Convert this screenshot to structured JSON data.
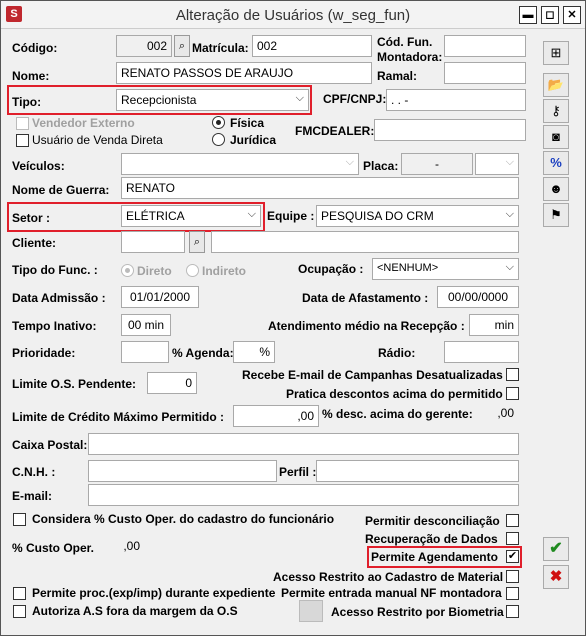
{
  "window": {
    "title": "Alteração de Usuários (w_seg_fun)",
    "app_icon": "S"
  },
  "codigo": {
    "label": "Código:",
    "value": "002"
  },
  "matricula": {
    "label": "Matrícula:",
    "value": "002"
  },
  "cod_fun_montadora": {
    "label_1": "Cód. Fun.",
    "label_2": "Montadora:",
    "value": ""
  },
  "nome": {
    "label": "Nome:",
    "value": "RENATO PASSOS DE ARAUJO"
  },
  "ramal": {
    "label": "Ramal:",
    "value": ""
  },
  "tipo": {
    "label": "Tipo:",
    "value": "Recepcionista"
  },
  "cpf": {
    "label": "CPF/CNPJ:",
    "value": " .  .  -"
  },
  "vendedor_externo": {
    "label": "Vendedor Externo",
    "checked": false
  },
  "usuario_venda_direta": {
    "label": "Usuário de Venda Direta",
    "checked": false
  },
  "pessoa": {
    "fisica": "Física",
    "juridica": "Jurídica",
    "selected": "fisica"
  },
  "fmcdealer": {
    "label": "FMCDEALER:",
    "value": ""
  },
  "veiculos": {
    "label": "Veículos:",
    "value": ""
  },
  "placa": {
    "label": "Placa:",
    "value": "-"
  },
  "nome_guerra": {
    "label": "Nome de Guerra:",
    "value": "RENATO"
  },
  "setor": {
    "label": "Setor :",
    "value": "ELÉTRICA"
  },
  "equipe": {
    "label": "Equipe :",
    "value": "PESQUISA DO CRM"
  },
  "cliente": {
    "label": "Cliente:",
    "value": ""
  },
  "tipo_func": {
    "label": "Tipo do Func. :",
    "direto": "Direto",
    "indireto": "Indireto",
    "selected": "direto"
  },
  "ocupacao": {
    "label": "Ocupação :",
    "value": "<NENHUM>"
  },
  "data_admissao": {
    "label": "Data Admissão :",
    "value": "01/01/2000"
  },
  "data_afastamento": {
    "label": "Data de Afastamento :",
    "value": "00/00/0000"
  },
  "tempo_inativo": {
    "label": "Tempo Inativo:",
    "value": "00 min"
  },
  "atendimento_medio": {
    "label": "Atendimento médio na Recepção :",
    "value": "min"
  },
  "prioridade": {
    "label": "Prioridade:",
    "value": ""
  },
  "agenda": {
    "label": "% Agenda:",
    "value": "%"
  },
  "radio_field": {
    "label": "Rádio:",
    "value": ""
  },
  "limite_os": {
    "label": "Limite O.S. Pendente:",
    "value": "0"
  },
  "recebe_email": {
    "label": "Recebe E-mail de Campanhas Desatualizadas",
    "checked": false
  },
  "pratica_descontos": {
    "label": "Pratica descontos acima do permitido",
    "checked": false
  },
  "limite_credito": {
    "label": "Limite de Crédito Máximo Permitido :",
    "value": ",00"
  },
  "desc_gerente": {
    "label": "% desc. acima do gerente:",
    "value": ",00"
  },
  "caixa_postal": {
    "label": "Caixa Postal:",
    "value": ""
  },
  "cnh": {
    "label": "C.N.H. :",
    "value": ""
  },
  "perfil": {
    "label": "Perfil :",
    "value": ""
  },
  "email": {
    "label": "E-mail:",
    "value": ""
  },
  "considera_custo": {
    "label": "Considera % Custo Oper. do cadastro do funcionário",
    "checked": false
  },
  "permitir_desconciliacao": {
    "label": "Permitir desconciliação",
    "checked": false
  },
  "custo_oper": {
    "label": "% Custo Oper.",
    "value": ",00"
  },
  "recuperacao_dados": {
    "label": "Recuperação de Dados",
    "checked": false
  },
  "permite_agendamento": {
    "label": "Permite Agendamento",
    "checked": true,
    "check_glyph": "✔"
  },
  "acesso_restrito_material": {
    "label": "Acesso Restrito ao Cadastro de Material",
    "checked": false
  },
  "permite_proc": {
    "label": "Permite proc.(exp/imp) durante expediente",
    "checked": false
  },
  "permite_entrada_nf": {
    "label": "Permite entrada manual NF montadora",
    "checked": false
  },
  "autoriza_as": {
    "label": "Autoriza A.S fora da margem da O.S",
    "checked": false
  },
  "acesso_biometria": {
    "label": "Acesso Restrito por Biometria",
    "checked": false
  },
  "glyphs": {
    "dropdown": "⌵",
    "search": "⌕",
    "ok": "✔",
    "cancel": "✖",
    "percent": "%"
  },
  "colors": {
    "highlight": "#e01f2b",
    "ok_green": "#1f8a1f",
    "cancel_red": "#d01010"
  }
}
